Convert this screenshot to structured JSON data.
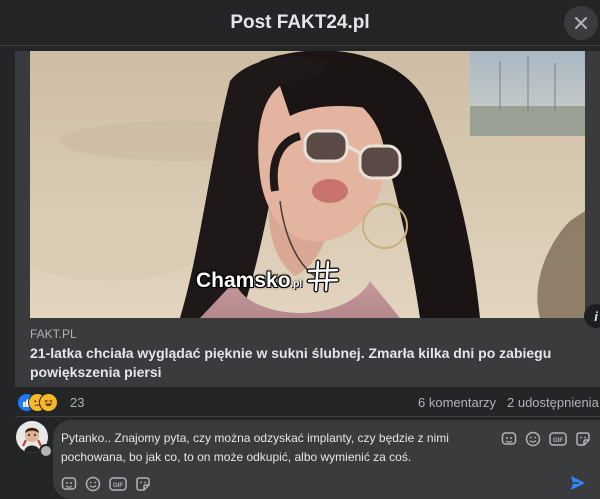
{
  "header": {
    "title": "Post FAKT24.pl"
  },
  "link_preview": {
    "watermark": "Chamsko",
    "watermark_suffix": ".pl",
    "domain": "FAKT.PL",
    "headline": "21-latka chciała wyglądać pięknie w sukni ślubnej. Zmarła kilka dni po zabiegu powiększenia piersi"
  },
  "stats": {
    "reaction_count": "23",
    "comments": "6 komentarzy",
    "shares": "2 udostępnienia"
  },
  "composer": {
    "text": "Pytanko.. Znajomy pyta, czy można odzyskać implanty, czy będzie z nimi pochowana, bo jak co, to on może odkupić, albo wymienić za coś."
  },
  "icons": {
    "close": "close-icon",
    "info": "info-icon",
    "send": "send-icon",
    "like": "like-reaction-icon",
    "sad": "sad-reaction-icon",
    "haha": "haha-reaction-icon",
    "sticker": "sticker-icon",
    "emoji": "emoji-icon",
    "gif": "gif-icon",
    "avatar_sticker": "avatar-sticker-icon"
  },
  "colors": {
    "background": "#242526",
    "surface": "#3a3b3c",
    "accent": "#2d88ff",
    "text": "#e4e6eb",
    "secondary_text": "#b0b3b8"
  }
}
